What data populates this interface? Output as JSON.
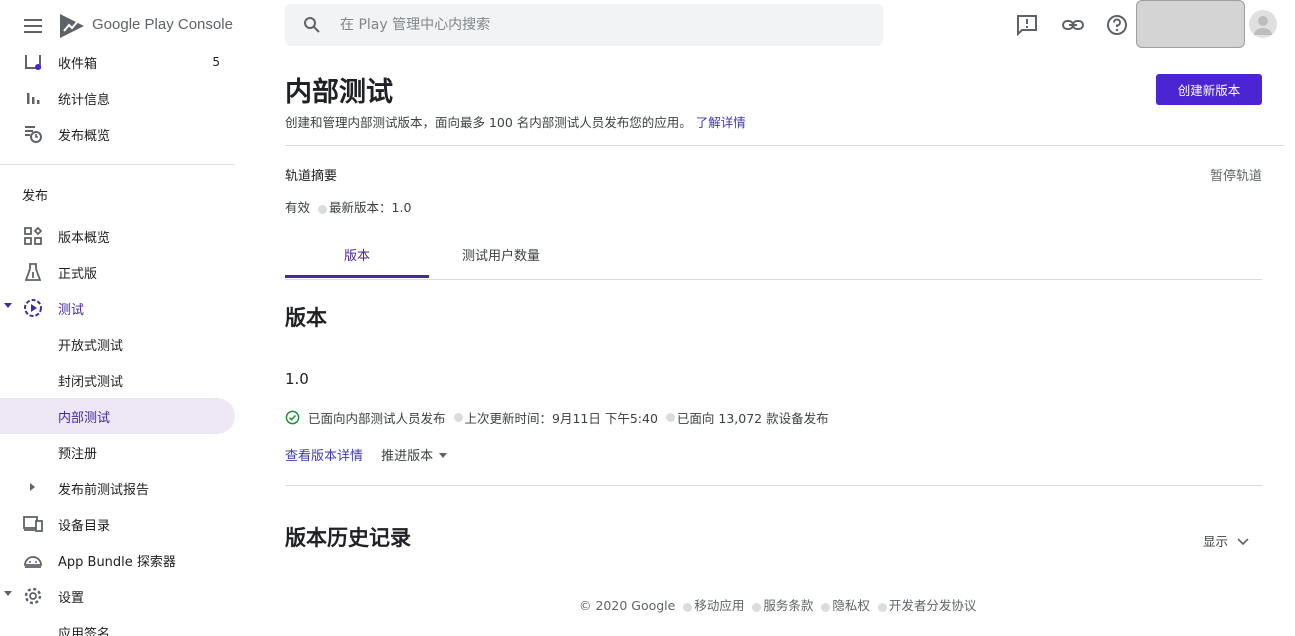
{
  "app": {
    "brand": "Google Play Console"
  },
  "search": {
    "placeholder": "在 Play 管理中心内搜索"
  },
  "sidebar": {
    "inbox": {
      "label": "收件箱",
      "count": "5"
    },
    "stats": {
      "label": "统计信息"
    },
    "release_overview": {
      "label": "发布概览"
    },
    "section_release": "发布",
    "releases_overview": {
      "label": "版本概览"
    },
    "production": {
      "label": "正式版"
    },
    "testing": {
      "label": "测试"
    },
    "open_testing": {
      "label": "开放式测试"
    },
    "closed_testing": {
      "label": "封闭式测试"
    },
    "internal_testing": {
      "label": "内部测试"
    },
    "pre_registration": {
      "label": "预注册"
    },
    "prelaunch_report": {
      "label": "发布前测试报告"
    },
    "device_catalog": {
      "label": "设备目录"
    },
    "bundle_explorer": {
      "label": "App Bundle 探索器"
    },
    "settings": {
      "label": "设置"
    },
    "app_signing": {
      "label": "应用签名"
    }
  },
  "page": {
    "title": "内部测试",
    "description": "创建和管理内部测试版本，面向最多 100 名内部测试人员发布您的应用。",
    "learn_more": "了解详情",
    "create_button": "创建新版本"
  },
  "track": {
    "summary_label": "轨道摘要",
    "pause_label": "暂停轨道",
    "status": "有效",
    "latest_version": "最新版本：1.0"
  },
  "tabs": [
    {
      "label": "版本",
      "active": true
    },
    {
      "label": "测试用户数量",
      "active": false
    }
  ],
  "releases": {
    "heading": "版本",
    "version": "1.0",
    "status": "已面向内部测试人员发布",
    "updated": "上次更新时间：9月11日 下午5:40",
    "devices": "已面向 13,072 款设备发布",
    "view_details": "查看版本详情",
    "promote": "推进版本"
  },
  "history": {
    "heading": "版本历史记录",
    "show_label": "显示"
  },
  "footer": {
    "copyright": "© 2020 Google",
    "links": [
      "移动应用",
      "服务条款",
      "隐私权",
      "开发者分发协议"
    ]
  },
  "colors": {
    "accent": "#4b24d4",
    "selected_bg": "#ede7f6",
    "success": "#1e8e3e"
  },
  "icons": [
    "menu-icon",
    "play-console-logo",
    "search-icon",
    "feedback-icon",
    "link-icon",
    "help-icon",
    "avatar-icon",
    "inbox-icon",
    "bar-chart-icon",
    "publishing-overview-icon",
    "dashboard-icon",
    "production-icon",
    "testing-icon",
    "device-catalog-icon",
    "android-icon",
    "gear-icon",
    "check-circle-icon",
    "chevron-down-icon"
  ]
}
